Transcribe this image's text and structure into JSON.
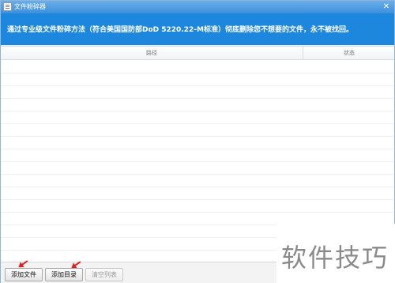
{
  "window": {
    "title": "文件粉碎器",
    "close_glyph": "✕"
  },
  "banner": {
    "text": "通过专业级文件粉碎方法（符合美国国防部DoD 5220.22-M标准）彻底删除您不想要的文件，永不被找回。"
  },
  "list": {
    "columns": {
      "path": "路径",
      "status": "状态"
    }
  },
  "toolbar": {
    "add_file": "添加文件",
    "add_dir": "添加目录",
    "clear_list": "清空列表"
  },
  "watermark": {
    "text": "软件技巧"
  },
  "colors": {
    "banner": "#1d87dd",
    "arrow": "#e02020"
  }
}
